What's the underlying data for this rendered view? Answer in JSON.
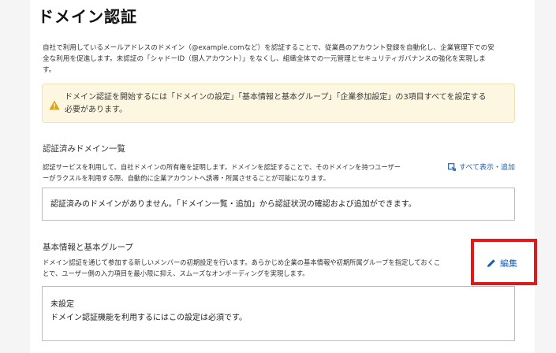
{
  "page": {
    "title": "ドメイン認証",
    "intro_line1": "自社で利用しているメールアドレスのドメイン（@example.comなど）を認証することで、従業員のアカウント登録を自動化し、企業管理下での安",
    "intro_line2": "全な利用を促進します。未認証の「シャドーID（個人アカウント）」をなくし、組織全体での一元管理とセキュリティガバナンスの強化を実現しま",
    "intro_line3": "す。"
  },
  "warning": {
    "icon": "warning-icon",
    "line1": "ドメイン認証を開始するには「ドメインの設定」「基本情報と基本グループ」「企業参加設定」の3項目すべてを設定する",
    "line2": "必要があります。",
    "color": "#d9a21b"
  },
  "verified_domains": {
    "heading": "認証済みドメイン一覧",
    "desc_line1": "認証サービスを利用して、自社ドメインの所有権を証明します。ドメインを認証することで、そのドメインを持つユーザー",
    "desc_line2": "ーがラクスルを利用する際、自動的に企業アカウントへ誘導・所属させることが可能になります。",
    "view_all_label": "すべて表示・追加",
    "empty_message": "認証済みのドメインがありません。「ドメイン一覧・追加」から認証状況の確認および追加ができます。"
  },
  "basic_info": {
    "heading": "基本情報と基本グループ",
    "desc_line1": "ドメイン認証を通じて参加する新しいメンバーの初期設定を行います。あらかじめ企業の基本情報や初期所属グループを指定しておくこ",
    "desc_line2": "とで、ユーザー側の入力項目を最小限に抑え、スムーズなオンボーディングを実現します。",
    "edit_label": "編集",
    "status": "未設定",
    "note": "ドメイン認証機能を利用するにはこの設定は必須です。"
  },
  "colors": {
    "link": "#1f5fb0",
    "highlight": "#e0191a"
  }
}
